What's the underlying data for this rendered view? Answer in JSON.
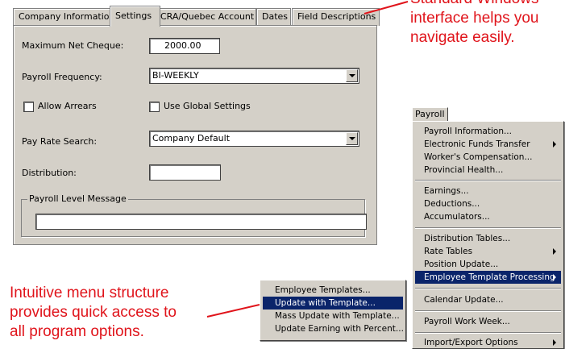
{
  "tabs": [
    {
      "label": "Company Information"
    },
    {
      "label": "Settings"
    },
    {
      "label": "CRA/Quebec Account"
    },
    {
      "label": "Dates"
    },
    {
      "label": "Field Descriptions"
    }
  ],
  "settings": {
    "max_net_cheque_label": "Maximum Net Cheque:",
    "max_net_cheque_value": "2000.00",
    "payroll_frequency_label": "Payroll Frequency:",
    "payroll_frequency_value": "BI-WEEKLY",
    "allow_arrears_label": "Allow Arrears",
    "use_global_label": "Use Global Settings",
    "pay_rate_search_label": "Pay Rate Search:",
    "pay_rate_search_value": "Company Default",
    "distribution_label": "Distribution:",
    "distribution_value": "",
    "payroll_level_message_label": "Payroll Level Message",
    "payroll_level_message_value": ""
  },
  "payroll_menu": {
    "title": "Payroll",
    "items": [
      "Payroll Information...",
      "Electronic Funds Transfer",
      "Worker's Compensation...",
      "Provincial Health...",
      "Earnings...",
      "Deductions...",
      "Accumulators...",
      "Distribution Tables...",
      "Rate Tables",
      "Position Update...",
      "Employee Template Processing",
      "Calendar Update...",
      "Payroll Work Week...",
      "Import/Export Options"
    ]
  },
  "template_submenu": {
    "items": [
      "Employee Templates...",
      "Update with Template...",
      "Mass Update with Template...",
      "Update Earning with Percent..."
    ]
  },
  "callouts": {
    "top_right": [
      "Standard Windows",
      "interface helps you",
      "navigate easily."
    ],
    "bottom_left": [
      "Intuitive menu structure",
      "provides quick access to",
      "all program options."
    ]
  },
  "colors": {
    "callout_text": "#e0141b",
    "menu_highlight": "#0a246a",
    "dialog_face": "#d4d0c8"
  }
}
